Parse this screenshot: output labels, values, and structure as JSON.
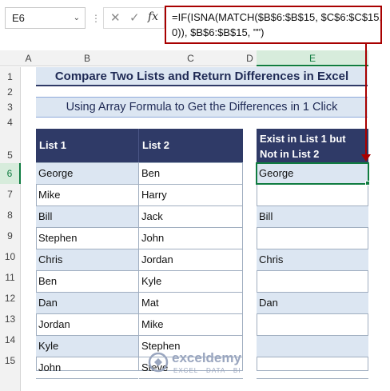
{
  "name_box": {
    "value": "E6"
  },
  "formula_bar": {
    "fx_label": "fx",
    "cancel_icon": "✕",
    "enter_icon": "✓",
    "formula_text": "=IF(ISNA(MATCH($B$6:$B$15, $C$6:$C$15,\n0)), $B$6:$B$15, \"\")"
  },
  "columns": [
    "A",
    "B",
    "C",
    "D",
    "E"
  ],
  "rows": [
    "1",
    "2",
    "3",
    "4",
    "5",
    "6",
    "7",
    "8",
    "9",
    "10",
    "11",
    "12",
    "13",
    "14",
    "15"
  ],
  "sheet": {
    "title": "Compare Two Lists and Return Differences in Excel",
    "subtitle": "Using Array Formula to Get the Differences in 1 Click",
    "headers": {
      "list1": "List 1",
      "list2": "List 2",
      "result_line1": "Exist in List 1 but",
      "result_line2": "Not in List 2"
    },
    "list1": [
      "George",
      "Mike",
      "Bill",
      "Stephen",
      "Chris",
      "Ben",
      "Dan",
      "Jordan",
      "Kyle",
      "John"
    ],
    "list2": [
      "Ben",
      "Harry",
      "Jack",
      "John",
      "Jordan",
      "Kyle",
      "Mat",
      "Mike",
      "Stephen",
      "Steve"
    ],
    "result": [
      "George",
      "",
      "Bill",
      "",
      "Chris",
      "",
      "Dan",
      "",
      "",
      ""
    ]
  },
  "watermark": {
    "name": "exceldemy",
    "tagline": "EXCEL · DATA · BI"
  },
  "colors": {
    "header_bg": "#2f3a67",
    "band": "#dce6f2",
    "accent_red": "#a80000",
    "select_green": "#107c41"
  }
}
